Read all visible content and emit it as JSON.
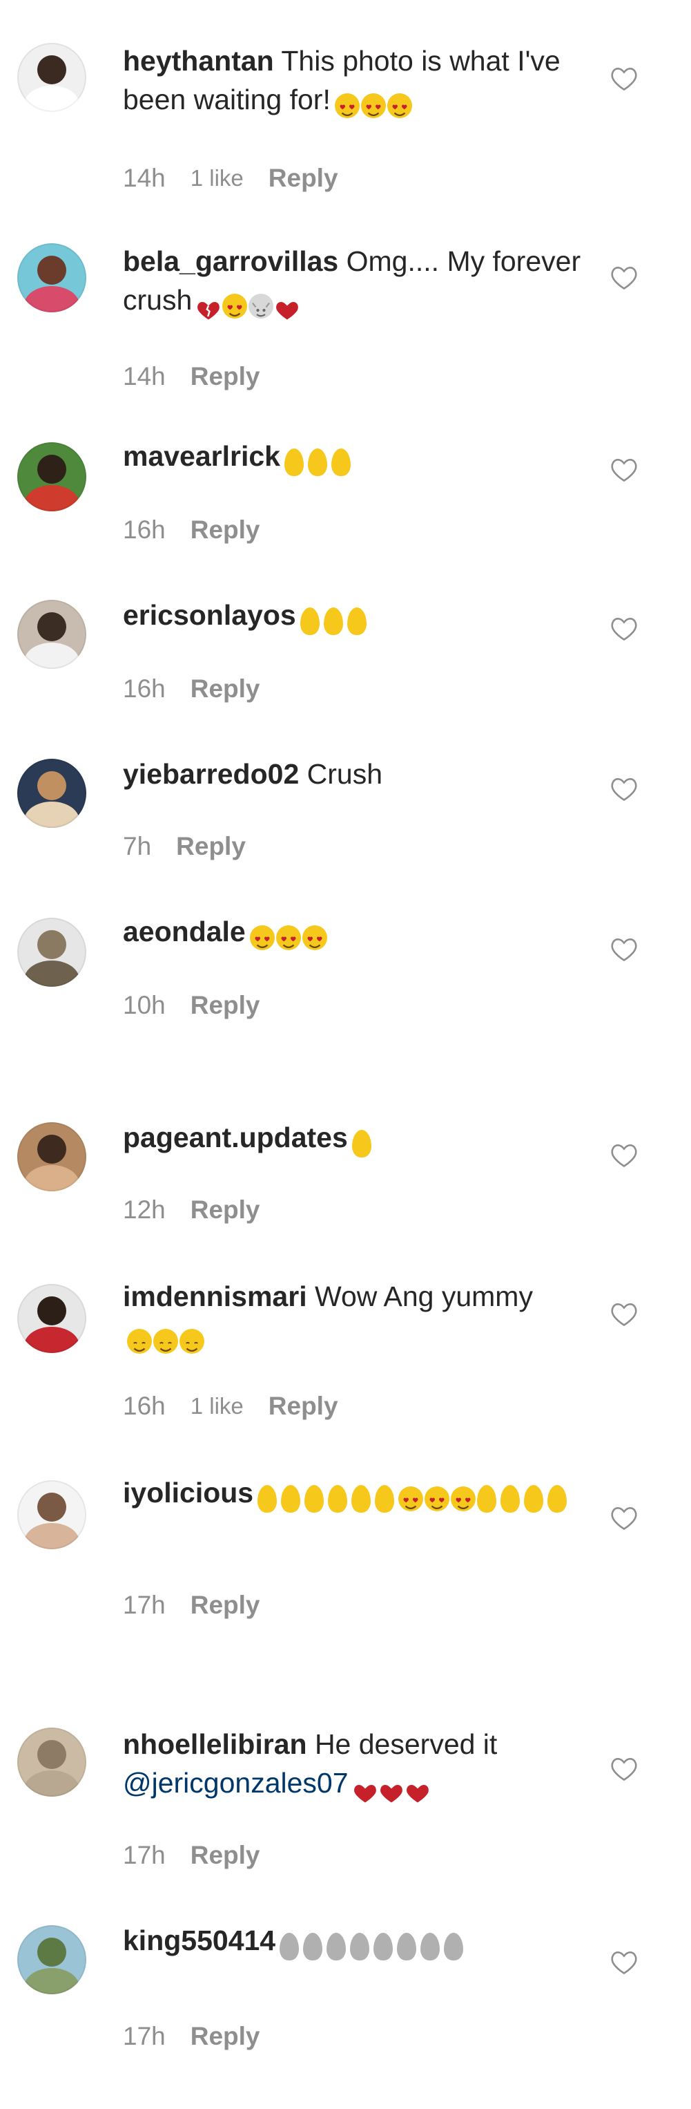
{
  "colors": {
    "text": "#262626",
    "meta": "#8e8e8e",
    "mention": "#00376b",
    "emoji_yellow": "#f7c81c",
    "emoji_red": "#c6202a",
    "emoji_gray": "#b0b0b0"
  },
  "comments": [
    {
      "username": "heythantan",
      "text": "This photo is what I've been waiting for!",
      "emojis": [
        "heart-eyes-emoji",
        "heart-eyes-emoji",
        "heart-eyes-emoji"
      ],
      "time": "14h",
      "likes": "1 like",
      "reply": "Reply",
      "avatar_icon": "man-portrait-avatar"
    },
    {
      "username": "bela_garrovillas",
      "text": "Omg.... My forever crush",
      "emojis": [
        "broken-heart-emoji",
        "heart-eyes-emoji",
        "smiling-cat-emoji",
        "red-heart-emoji"
      ],
      "time": "14h",
      "likes": "",
      "reply": "Reply",
      "avatar_icon": "woman-portrait-avatar"
    },
    {
      "username": "mavearlrick",
      "text": "",
      "emojis": [
        "yellow-hand-emoji",
        "yellow-hand-emoji",
        "yellow-hand-emoji"
      ],
      "time": "16h",
      "likes": "",
      "reply": "Reply",
      "avatar_icon": "man-red-shirt-avatar"
    },
    {
      "username": "ericsonlayos",
      "text": "",
      "emojis": [
        "yellow-hand-emoji",
        "yellow-hand-emoji",
        "yellow-hand-emoji"
      ],
      "time": "16h",
      "likes": "",
      "reply": "Reply",
      "avatar_icon": "man-portrait-avatar"
    },
    {
      "username": "yiebarredo02",
      "text": "Crush",
      "emojis": [],
      "time": "7h",
      "likes": "",
      "reply": "Reply",
      "avatar_icon": "photo-frame-avatar"
    },
    {
      "username": "aeondale",
      "text": "",
      "emojis": [
        "heart-eyes-emoji",
        "heart-eyes-emoji",
        "heart-eyes-emoji"
      ],
      "time": "10h",
      "likes": "",
      "reply": "Reply",
      "avatar_icon": "eiffel-tower-avatar"
    },
    {
      "username": "pageant.updates",
      "text": "",
      "emojis": [
        "yellow-hand-emoji"
      ],
      "time": "12h",
      "likes": "",
      "reply": "Reply",
      "avatar_icon": "woman-portrait-avatar"
    },
    {
      "username": "imdennismari",
      "text": "Wow Ang yummy",
      "emojis": [
        "smiling-face-emoji",
        "smiling-face-emoji",
        "smiling-face-emoji"
      ],
      "time": "16h",
      "likes": "1 like",
      "reply": "Reply",
      "avatar_icon": "man-red-shirt-avatar"
    },
    {
      "username": "iyolicious",
      "text": "",
      "emojis": [
        "yellow-hand-emoji",
        "yellow-hand-emoji",
        "yellow-hand-emoji",
        "yellow-hand-emoji",
        "yellow-hand-emoji",
        "yellow-hand-emoji",
        "heart-eyes-emoji",
        "heart-eyes-emoji",
        "heart-eyes-emoji",
        "yellow-hand-emoji",
        "yellow-hand-emoji",
        "yellow-hand-emoji",
        "yellow-hand-emoji"
      ],
      "time": "17h",
      "likes": "",
      "reply": "Reply",
      "avatar_icon": "woman-portrait-avatar"
    },
    {
      "username": "nhoellelibiran",
      "text": "He deserved it",
      "mention": "@jericgonzales07",
      "emojis": [
        "red-heart-emoji",
        "red-heart-emoji",
        "red-heart-emoji"
      ],
      "time": "17h",
      "likes": "",
      "reply": "Reply",
      "avatar_icon": "blurred-portrait-avatar"
    },
    {
      "username": "king550414",
      "text": "",
      "emojis": [
        "gray-hand-emoji",
        "gray-hand-emoji",
        "gray-hand-emoji",
        "gray-hand-emoji",
        "gray-hand-emoji",
        "gray-hand-emoji",
        "gray-hand-emoji",
        "gray-hand-emoji"
      ],
      "time": "17h",
      "likes": "",
      "reply": "Reply",
      "avatar_icon": "landscape-avatar"
    }
  ]
}
